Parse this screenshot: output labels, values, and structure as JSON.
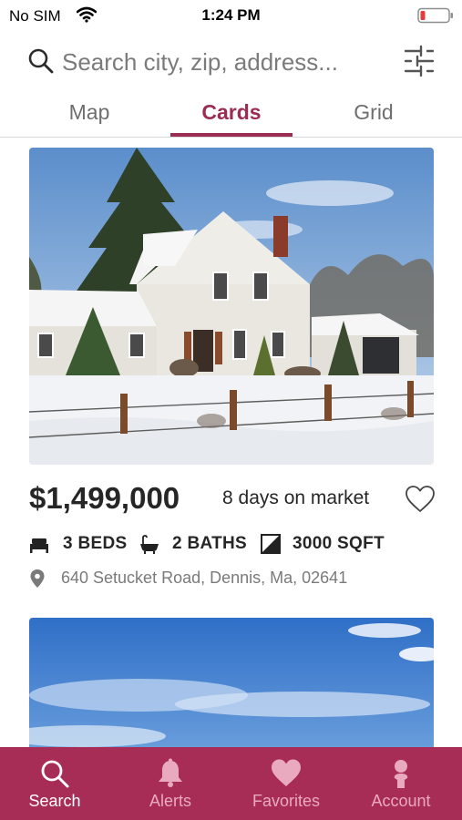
{
  "status_bar": {
    "carrier": "No SIM",
    "time": "1:24 PM",
    "battery_color": "#e53b3b"
  },
  "search": {
    "placeholder": "Search city, zip, address...",
    "search_icon": "search-icon",
    "filter_icon": "sliders-icon"
  },
  "tabs": [
    {
      "label": "Map",
      "active": false
    },
    {
      "label": "Cards",
      "active": true
    },
    {
      "label": "Grid",
      "active": false
    }
  ],
  "listing": {
    "photo": "snowy-farmhouse-photo",
    "price": "$1,499,000",
    "days_on_market": "8 days on market",
    "favorite_icon": "heart-outline-icon",
    "beds": "3 BEDS",
    "baths": "2 BATHS",
    "sqft": "3000 SQFT",
    "address": "640 Setucket Road, Dennis, Ma, 02641"
  },
  "next_listing": {
    "photo": "blue-sky-photo"
  },
  "bottom_nav": [
    {
      "label": "Search",
      "icon": "search-icon",
      "active": true
    },
    {
      "label": "Alerts",
      "icon": "bell-icon",
      "active": false
    },
    {
      "label": "Favorites",
      "icon": "heart-icon",
      "active": false
    },
    {
      "label": "Account",
      "icon": "person-icon",
      "active": false
    }
  ],
  "colors": {
    "accent": "#9b2d52",
    "nav_background": "#a72d57",
    "nav_inactive": "#e9aabf"
  }
}
